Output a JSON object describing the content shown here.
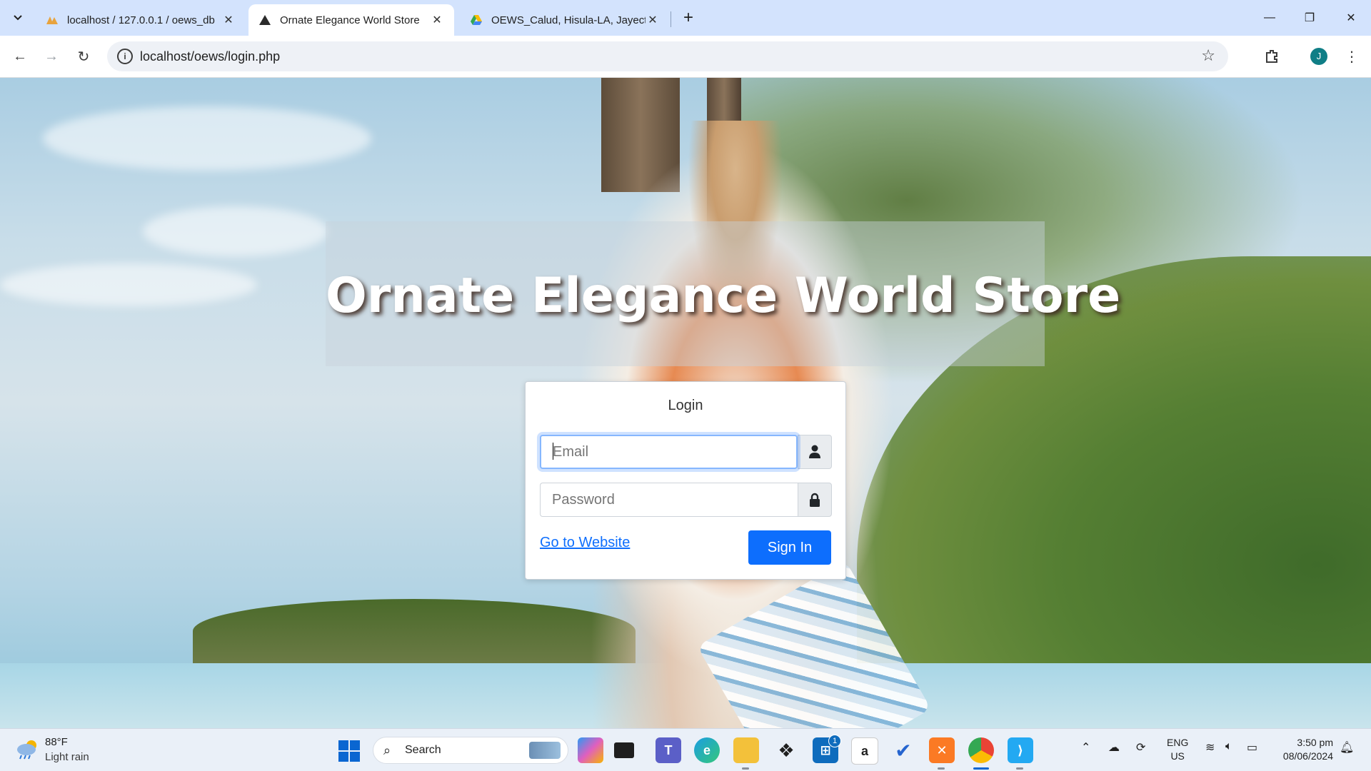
{
  "browser": {
    "tabs": [
      {
        "title": "localhost / 127.0.0.1 / oews_db",
        "favicon": "phpmyadmin-icon",
        "active": false
      },
      {
        "title": "Ornate Elegance World Store",
        "favicon": "site-favicon-icon",
        "active": true
      },
      {
        "title": "OEWS_Calud, Hisula-LA, Jayecti",
        "favicon": "google-drive-icon",
        "active": false
      }
    ],
    "new_tab": "+",
    "address": "localhost/oews/login.php",
    "profile_initial": "J"
  },
  "page": {
    "store_title": "Ornate Elegance World Store",
    "login": {
      "heading": "Login",
      "email_placeholder": "Email",
      "password_placeholder": "Password",
      "website_link": "Go to Website",
      "signin_label": "Sign In"
    }
  },
  "taskbar": {
    "weather": {
      "temp": "88°F",
      "desc": "Light rain"
    },
    "search_label": "Search",
    "apps": [
      "copilot-icon",
      "task-view-icon",
      "teams-icon",
      "edge-icon",
      "file-explorer-icon",
      "dropbox-icon",
      "microsoft-store-icon",
      "amazon-icon",
      "todo-icon",
      "xampp-icon",
      "chrome-icon",
      "vscode-icon"
    ],
    "store_badge": "1",
    "language": {
      "line1": "ENG",
      "line2": "US"
    },
    "clock": {
      "time": "3:50 pm",
      "date": "08/06/2024"
    }
  },
  "colors": {
    "accent": "#0d6efd",
    "tabstrip": "#d3e3fd",
    "link": "#0d6efd"
  }
}
